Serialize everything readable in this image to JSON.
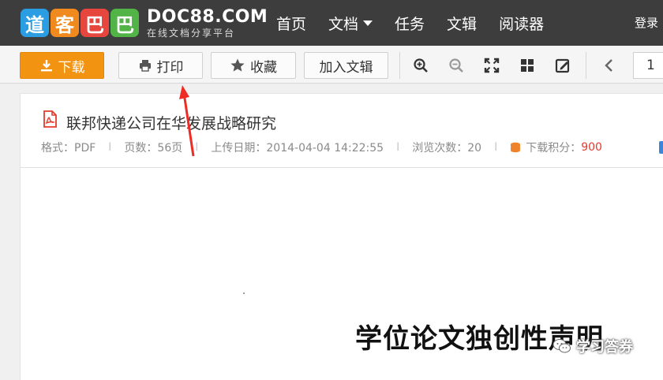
{
  "header": {
    "logo_chars": [
      "道",
      "客",
      "巴",
      "巴"
    ],
    "logo_domain": "DOC88.COM",
    "logo_slogan": "在线文档分享平台",
    "nav": [
      {
        "label": "首页"
      },
      {
        "label": "文档"
      },
      {
        "label": "任务"
      },
      {
        "label": "文辑"
      },
      {
        "label": "阅读器"
      }
    ],
    "login_label": "登录"
  },
  "toolbar": {
    "download_label": "下载",
    "print_label": "打印",
    "favorite_label": "收藏",
    "add_collection_label": "加入文辑",
    "page_number": "1"
  },
  "document": {
    "title": "联邦快递公司在华发展战略研究",
    "format_label": "格式：PDF",
    "pages_label": "页数：56页",
    "upload_date_label": "上传日期：2014-04-04 14:22:55",
    "views_label": "浏览次数：20",
    "points_label": "下载积分：",
    "points_value": "900",
    "page_heading": "学位论文独创性声明"
  },
  "watermark": {
    "text": "学习答券"
  },
  "colors": {
    "nav_bg": "#3d3d3d",
    "download_btn": "#f29311",
    "accent_red": "#e23c2e",
    "annotation_arrow": "#ee2b24"
  }
}
